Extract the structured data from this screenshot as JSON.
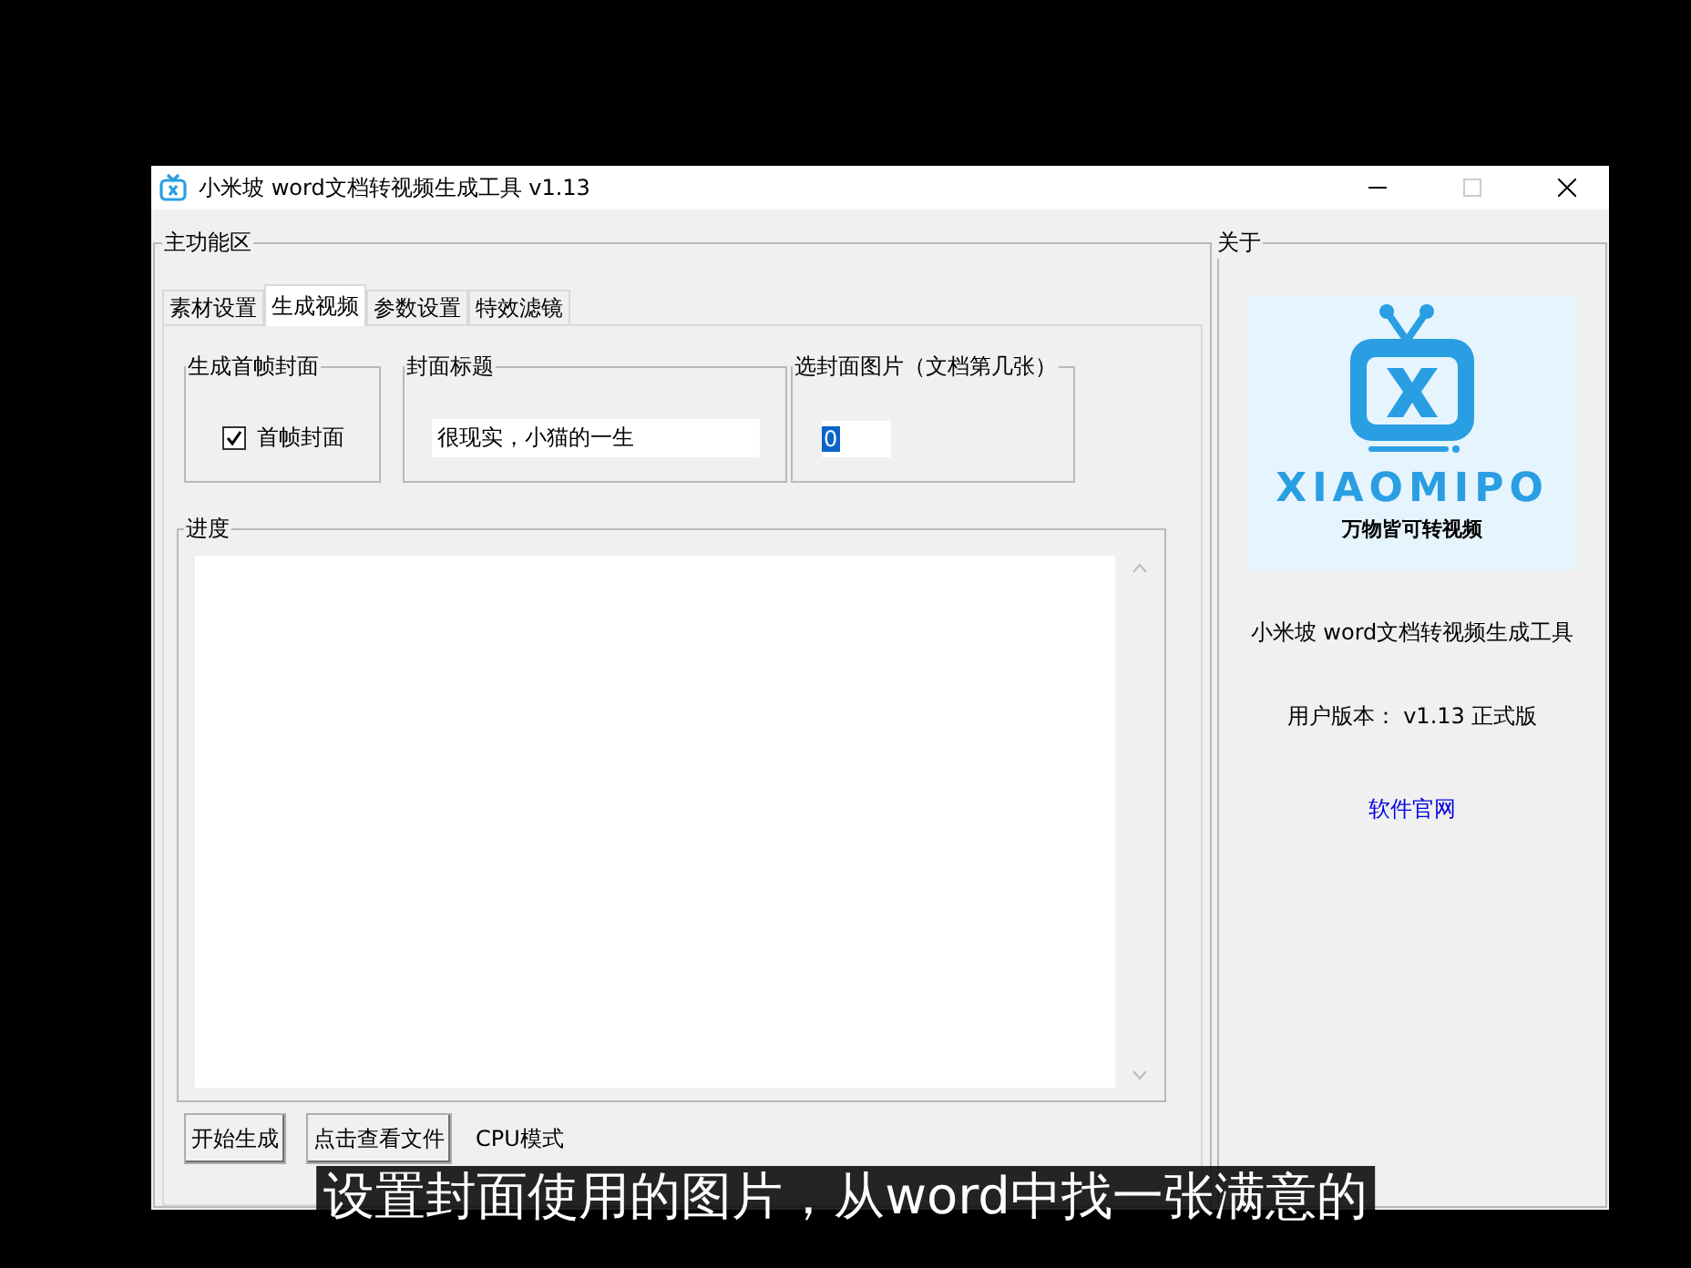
{
  "window": {
    "title": "小米坡 word文档转视频生成工具 v1.13"
  },
  "main_group": {
    "title": "主功能区",
    "tabs": [
      {
        "label": "素材设置",
        "selected": false
      },
      {
        "label": "生成视频",
        "selected": true
      },
      {
        "label": "参数设置",
        "selected": false
      },
      {
        "label": "特效滤镜",
        "selected": false
      }
    ],
    "cover_frame": {
      "title": "生成首帧封面",
      "checkbox": {
        "label": "首帧封面",
        "checked": true
      }
    },
    "cover_title": {
      "title": "封面标题",
      "value": "很现实，小猫的一生"
    },
    "cover_image": {
      "title": "选封面图片（文档第几张）",
      "value": "0"
    },
    "progress": {
      "title": "进度"
    },
    "buttons": [
      "开始生成",
      "点击查看文件"
    ],
    "mode_label": "CPU模式"
  },
  "about": {
    "title": "关于",
    "logo_word": "XIAOMIPO",
    "logo_slogan": "万物皆可转视频",
    "app_name": "小米坡 word文档转视频生成工具",
    "version": "用户版本： v1.13 正式版",
    "website_link": "软件官网"
  },
  "subtitle": "设置封面使用的图片，从word中找一张满意的"
}
